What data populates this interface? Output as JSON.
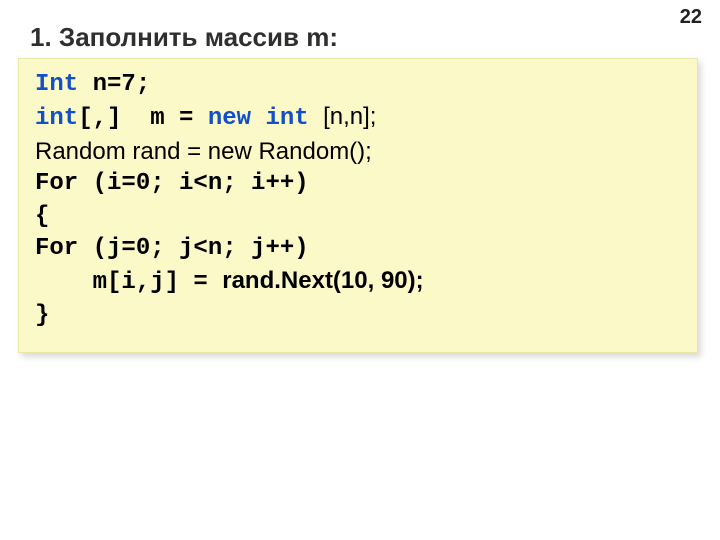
{
  "page_number": "22",
  "title": "1. Заполнить массив m:",
  "code": {
    "l1": {
      "a": "Int ",
      "b": "n=7;"
    },
    "l2": {
      "a": "int",
      "b": "[,]  ",
      "c": "m = ",
      "d": "new int ",
      "e": "[n,n];"
    },
    "l3": "Random rand = new Random();",
    "l4": "For (i=0; i<n; i++)",
    "l5": "{",
    "l6": "For (j=0; j<n; j++)",
    "l7": {
      "a": "    m[i,j] = ",
      "b": "rand.Next(10, 90);"
    },
    "l8": "}"
  }
}
